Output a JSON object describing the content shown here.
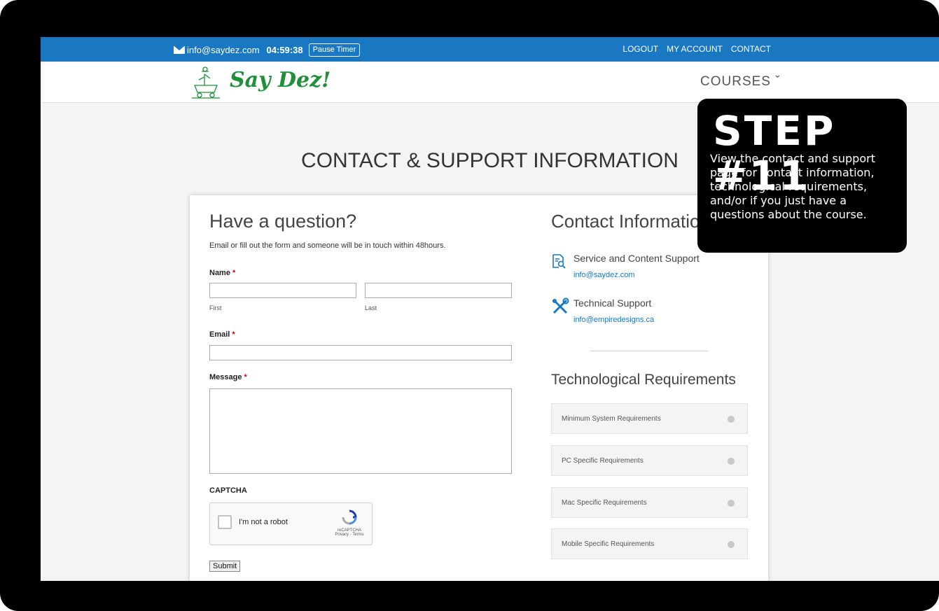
{
  "topbar": {
    "email": "info@saydez.com",
    "timer": "04:59:38",
    "pause_label": "Pause Timer",
    "nav": [
      "LOGOUT",
      "MY ACCOUNT",
      "CONTACT"
    ]
  },
  "header": {
    "logo_text": "Say Dez!",
    "courses_label": "COURSES ˇ"
  },
  "page": {
    "title": "CONTACT & SUPPORT INFORMATION"
  },
  "form": {
    "title": "Have a question?",
    "subtitle": "Email or fill out the form and someone will be in touch within 48hours.",
    "name_label": "Name",
    "first_label": "First",
    "last_label": "Last",
    "email_label": "Email",
    "message_label": "Message",
    "required_mark": "*",
    "captcha_label": "CAPTCHA",
    "captcha_checkbox": "I'm not a robot",
    "captcha_brand": "reCAPTCHA",
    "captcha_links": "Privacy - Terms",
    "submit_label": "Submit"
  },
  "contact": {
    "title": "Contact Information",
    "items": [
      {
        "title": "Service and Content Support",
        "email": "info@saydez.com",
        "icon": "document-search-icon"
      },
      {
        "title": "Technical Support",
        "email": "info@empiredesigns.ca",
        "icon": "tools-icon"
      }
    ]
  },
  "tech": {
    "title": "Technological Requirements",
    "items": [
      "Minimum System Requirements",
      "PC Specific Requirements",
      "Mac Specific Requirements",
      "Mobile Specific Requirements"
    ]
  },
  "step": {
    "heading": "STEP #11",
    "description": "View the contact and support page for contact information, technological requirements, and/or if you just have a questions about the course."
  },
  "colors": {
    "topbar": "#1a78c2",
    "link": "#1a78c2",
    "logo_green": "#1f8f3a"
  }
}
